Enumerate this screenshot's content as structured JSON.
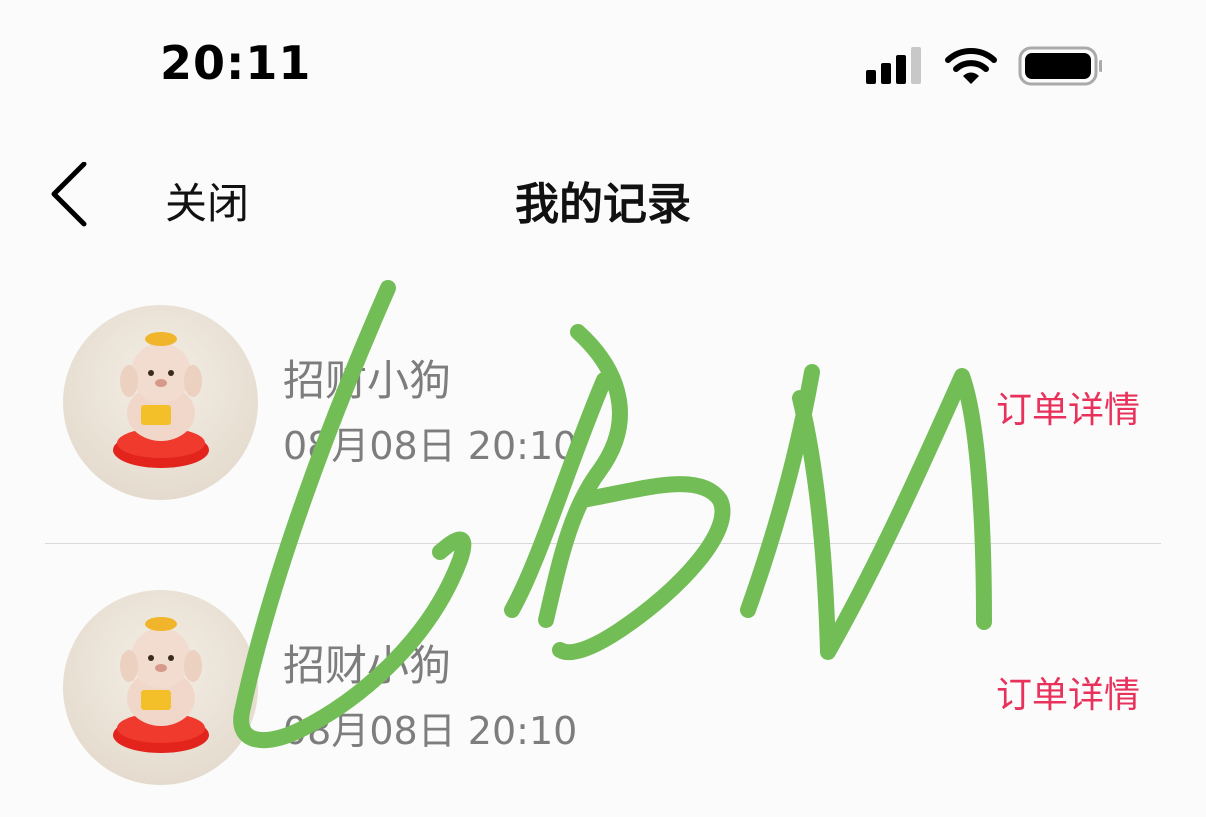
{
  "status_bar": {
    "time": "20:11"
  },
  "nav": {
    "close_label": "关闭",
    "title": "我的记录"
  },
  "records": [
    {
      "name": "招财小狗",
      "time": "08月08日 20:10",
      "link_label": "订单详情"
    },
    {
      "name": "招财小狗",
      "time": "08月08日 20:10",
      "link_label": "订单详情"
    }
  ],
  "colors": {
    "link": "#e8315b",
    "secondary_text": "#7d7d7d",
    "signature": "#73bd57"
  },
  "icons": {
    "back": "chevron-left-icon",
    "signal": "cellular-signal-icon",
    "wifi": "wifi-icon",
    "battery": "battery-icon"
  }
}
